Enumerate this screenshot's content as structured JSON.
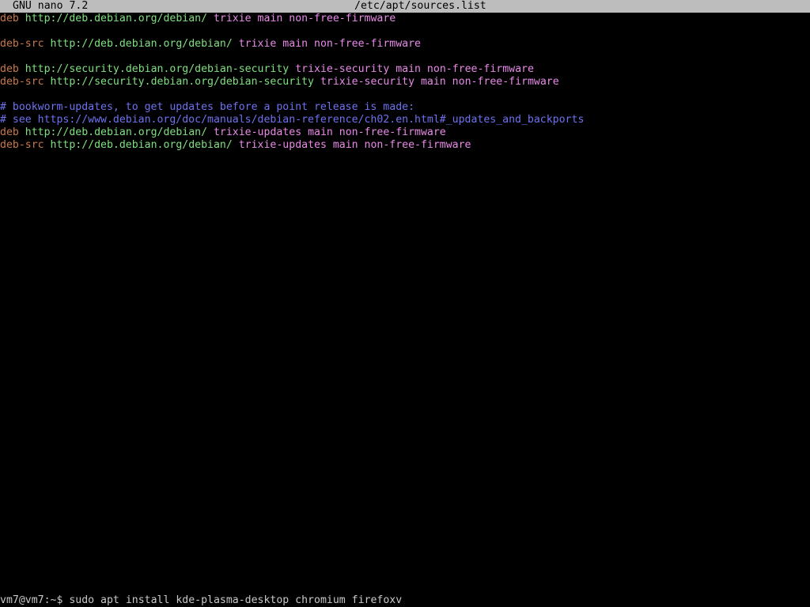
{
  "titlebar": {
    "app_name": "GNU nano 7.2",
    "file_path": "/etc/apt/sources.list"
  },
  "colors": {
    "background": "#000000",
    "titlebar_bg": "#bdbdbd",
    "type_keyword": "#c97a4a",
    "url": "#7fe07f",
    "suite_words": "#e88ae8",
    "comment": "#6f72f0",
    "plain_text": "#c8c8c8"
  },
  "editor": {
    "lines": [
      {
        "type": "deb",
        "url": "http://deb.debian.org/debian/",
        "rest": "trixie main non-free-firmware",
        "comment": ""
      },
      {
        "type": "",
        "url": "",
        "rest": "",
        "comment": ""
      },
      {
        "type": "deb-src",
        "url": "http://deb.debian.org/debian/",
        "rest": "trixie main non-free-firmware",
        "comment": ""
      },
      {
        "type": "",
        "url": "",
        "rest": "",
        "comment": ""
      },
      {
        "type": "deb",
        "url": "http://security.debian.org/debian-security",
        "rest": "trixie-security main non-free-firmware",
        "comment": ""
      },
      {
        "type": "deb-src",
        "url": "http://security.debian.org/debian-security",
        "rest": "trixie-security main non-free-firmware",
        "comment": ""
      },
      {
        "type": "",
        "url": "",
        "rest": "",
        "comment": ""
      },
      {
        "type": "",
        "url": "",
        "rest": "",
        "comment": "# bookworm-updates, to get updates before a point release is made:"
      },
      {
        "type": "",
        "url": "",
        "rest": "",
        "comment": "# see https://www.debian.org/doc/manuals/debian-reference/ch02.en.html#_updates_and_backports"
      },
      {
        "type": "deb",
        "url": "http://deb.debian.org/debian/",
        "rest": "trixie-updates main non-free-firmware",
        "comment": ""
      },
      {
        "type": "deb-src",
        "url": "http://deb.debian.org/debian/",
        "rest": "trixie-updates main non-free-firmware",
        "comment": ""
      }
    ]
  },
  "shell": {
    "prompt": "vm7@vm7:~$",
    "command": "sudo apt install kde-plasma-desktop chromium firefoxv"
  }
}
